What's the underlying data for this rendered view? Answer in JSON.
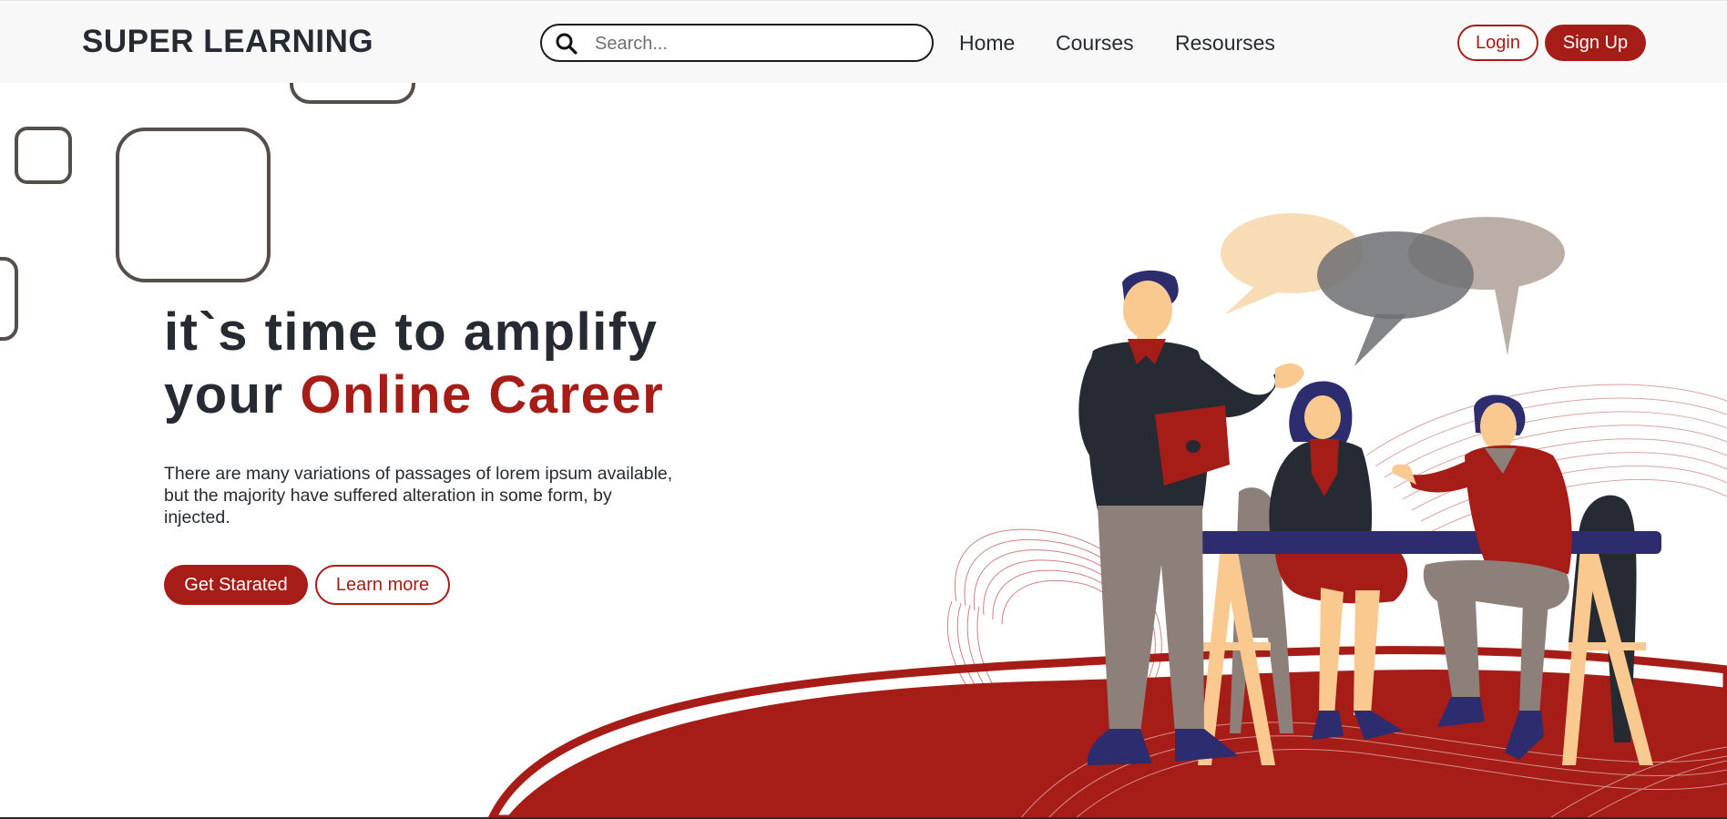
{
  "header": {
    "brand": "SUPER LEARNING",
    "search": {
      "placeholder": "Search..."
    },
    "nav": [
      "Home",
      "Courses",
      "Resourses"
    ],
    "login_label": "Login",
    "signup_label": "Sign Up"
  },
  "hero": {
    "title_line1": "it`s time to amplify",
    "title_line2_prefix": "your ",
    "title_line2_accent": "Online Career",
    "description": "There are many variations of passages of lorem ipsum available, but the majority have suffered alteration in some form, by injected.",
    "primary_button": "Get Starated",
    "secondary_button": "Learn more"
  },
  "icons": {
    "search": "search-icon"
  },
  "colors": {
    "accent": "#a51d16",
    "text_dark": "#262b33",
    "navbar_bg": "#f8f8f8",
    "navy": "#2d2c6e",
    "skin": "#f9c98f",
    "grey_pants": "#8d7f79"
  }
}
